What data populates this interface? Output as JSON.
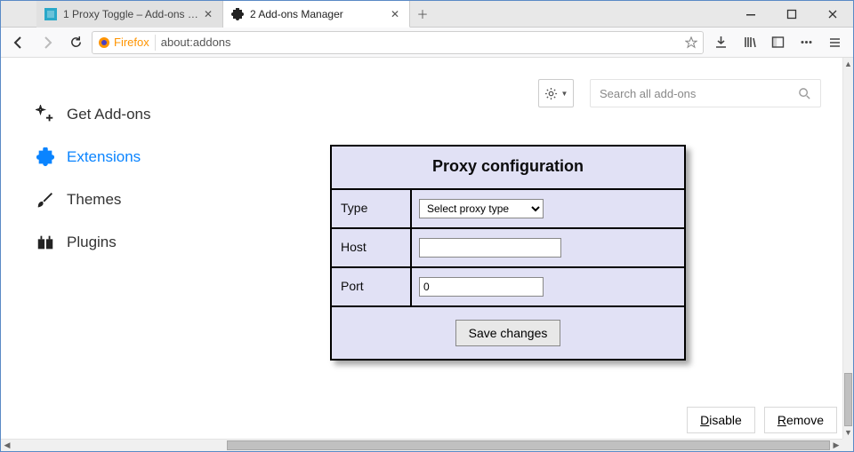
{
  "window": {
    "tabs": [
      {
        "index": "1",
        "label": "Proxy Toggle – Add-ons for Firefox",
        "active": false
      },
      {
        "index": "2",
        "label": "Add-ons Manager",
        "active": true
      }
    ]
  },
  "navbar": {
    "brand": "Firefox",
    "address": "about:addons"
  },
  "controls": {
    "search_placeholder": "Search all add-ons"
  },
  "sidebar": {
    "items": [
      {
        "label": "Get Add-ons"
      },
      {
        "label": "Extensions"
      },
      {
        "label": "Themes"
      },
      {
        "label": "Plugins"
      }
    ],
    "active_index": 1
  },
  "proxy_panel": {
    "title": "Proxy configuration",
    "type_label": "Type",
    "type_placeholder": "Select proxy type",
    "host_label": "Host",
    "host_value": "",
    "port_label": "Port",
    "port_value": "0",
    "save_label": "Save changes"
  },
  "buttons": {
    "disable": "Disable",
    "remove": "Remove"
  }
}
